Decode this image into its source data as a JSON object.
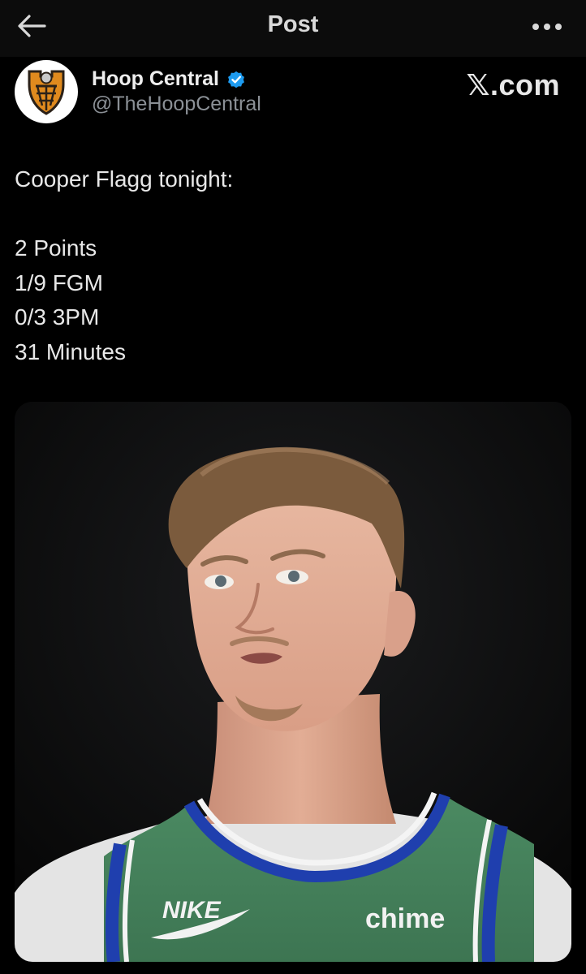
{
  "topbar": {
    "title": "Post",
    "back_icon": "arrow-left-icon",
    "more_icon": "more-horizontal-icon"
  },
  "author": {
    "display_name": "Hoop Central",
    "handle": "@TheHoopCentral",
    "verified": true,
    "verified_color": "#1d9bf0",
    "avatar_icon": "hoop-central-logo"
  },
  "source": {
    "label": "𝕏.com"
  },
  "post": {
    "lines": [
      "Cooper Flagg tonight:",
      "",
      "2 Points",
      "1/9 FGM",
      "0/3 3PM",
      "31 Minutes"
    ]
  },
  "media": {
    "jersey_brand": "NIKE",
    "jersey_sponsor": "chime"
  }
}
